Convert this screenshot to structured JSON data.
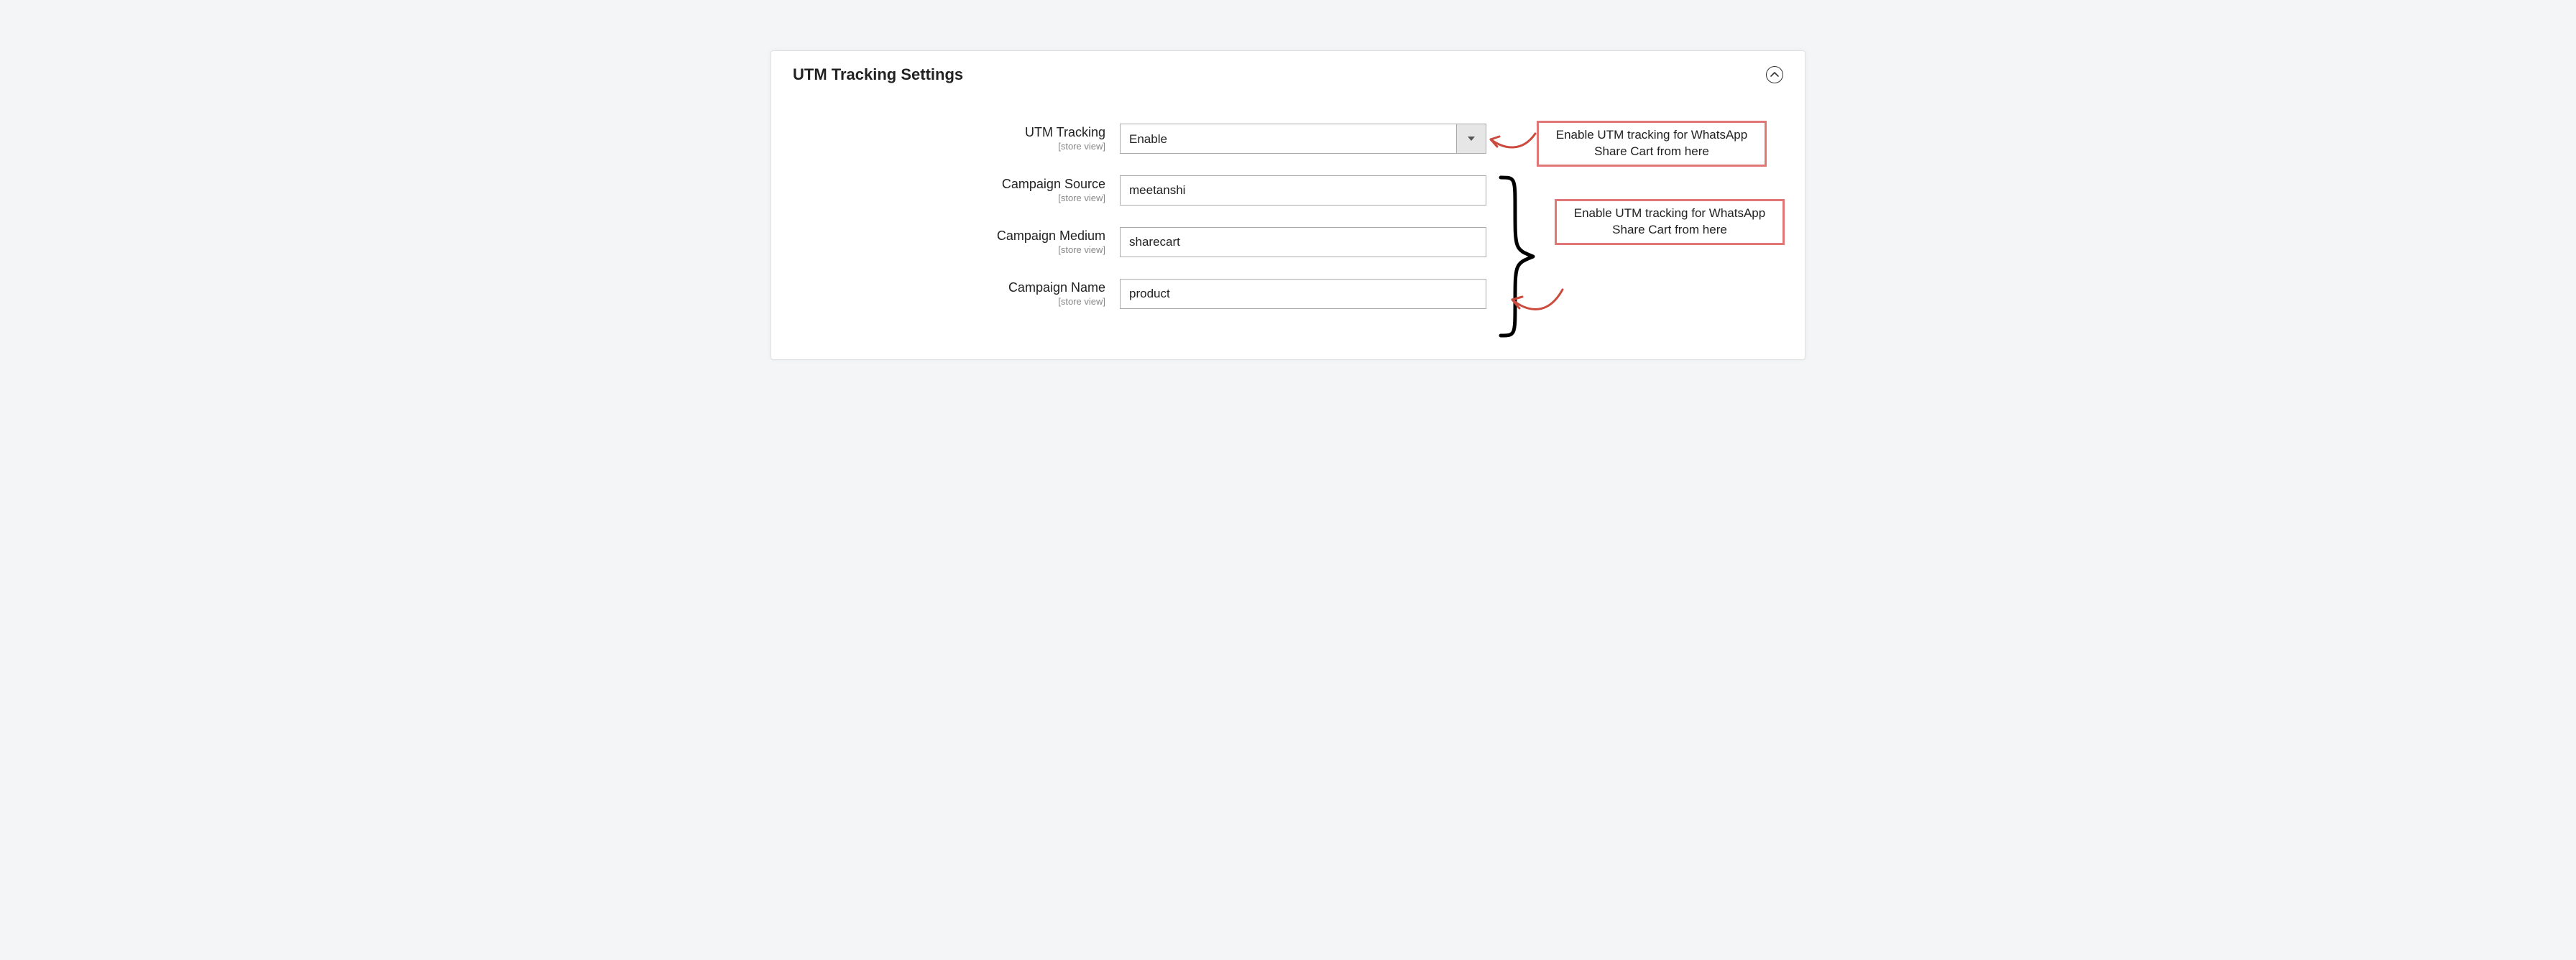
{
  "section": {
    "title": "UTM Tracking Settings"
  },
  "fields": {
    "utm_tracking": {
      "label": "UTM Tracking",
      "scope": "[store view]",
      "value": "Enable"
    },
    "campaign_source": {
      "label": "Campaign Source",
      "scope": "[store view]",
      "value": "meetanshi"
    },
    "campaign_medium": {
      "label": "Campaign Medium",
      "scope": "[store view]",
      "value": "sharecart"
    },
    "campaign_name": {
      "label": "Campaign Name",
      "scope": "[store view]",
      "value": "product"
    }
  },
  "callouts": {
    "top": "Enable UTM tracking for WhatsApp Share Cart from here",
    "bottom": "Enable UTM tracking for WhatsApp Share Cart from here"
  }
}
